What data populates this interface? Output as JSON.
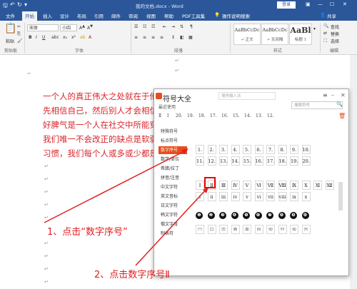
{
  "titlebar": {
    "document_title": "我的文档.docx  -  Word",
    "login": "登录",
    "window_icons": [
      "restore-icon",
      "minimize-icon",
      "maximize-icon",
      "close-icon"
    ]
  },
  "ribbon_tabs": [
    "文件",
    "开始",
    "插入",
    "设计",
    "布局",
    "引用",
    "邮件",
    "审阅",
    "视图",
    "帮助",
    "PDF工具集",
    "操作说明搜索",
    "共享"
  ],
  "ribbon": {
    "clipboard": {
      "label": "剪贴板",
      "paste": "粘贴"
    },
    "font": {
      "label": "字体",
      "font_name": "宋体",
      "font_size": "小四",
      "bold": "B",
      "italic": "I",
      "underline": "U"
    },
    "paragraph": {
      "label": "段落"
    },
    "styles": {
      "label": "样式",
      "items": [
        {
          "preview": "AaBbCcDc",
          "name": "↵ 正文"
        },
        {
          "preview": "AaBbCcDc",
          "name": "↵ 无间隔"
        },
        {
          "preview": "AaBl",
          "name": "标题 1"
        }
      ]
    },
    "editing": {
      "label": "编辑",
      "find": "查找",
      "replace": "替换",
      "select": "选择"
    }
  },
  "document": {
    "lines": [
      "一个人的真正伟大之处就在于他能",
      "先相信自己，然后别人才会相信你",
      "好脾气是一个人在社交中所能穿着",
      "我们唯一不会改正的缺点是软弱。",
      "习惯，我们每个人或多或少都是它"
    ]
  },
  "dialog": {
    "title": "符号大全",
    "input_placeholder": "搜狗输入法",
    "search_placeholder": "搜索符号",
    "recent_label": "最近使用",
    "recent_items": [
      "Ⅱ",
      "Ⅰ",
      "20.",
      "19.",
      "18.",
      "17.",
      "16.",
      "15.",
      "14.",
      "13.",
      "12."
    ],
    "categories": [
      "特殊符号",
      "标点符号",
      "数字序号",
      "数学/单位",
      "希腊/拉丁",
      "拼音/注音",
      "中文字符",
      "英文音标",
      "日文字符",
      "韩文字符",
      "俄文字母",
      "制表符"
    ],
    "selected_category": "数字序号",
    "grid_rows": [
      [
        "1.",
        "2.",
        "3.",
        "4.",
        "5.",
        "6.",
        "7.",
        "8.",
        "9.",
        "10."
      ],
      [
        "11.",
        "12.",
        "13.",
        "14.",
        "15.",
        "16.",
        "17.",
        "18.",
        "19.",
        "20."
      ],
      [
        "Ⅰ",
        "Ⅱ",
        "Ⅲ",
        "Ⅳ",
        "Ⅴ",
        "Ⅵ",
        "Ⅶ",
        "Ⅷ",
        "Ⅸ",
        "Ⅹ",
        "Ⅺ",
        "Ⅻ"
      ],
      [
        "ⅰ",
        "ⅱ",
        "ⅲ",
        "ⅳ",
        "ⅴ",
        "ⅵ",
        "ⅶ",
        "ⅷ",
        "ⅸ",
        "ⅹ"
      ],
      [
        "❶",
        "❷",
        "❸",
        "❹",
        "❺",
        "❻",
        "❼",
        "❽",
        "❾",
        "❿"
      ],
      [
        "㈠",
        "㈡",
        "㈢",
        "㈣",
        "㈤",
        "㈥",
        "㈦",
        "㈧",
        "㈨",
        "㈩"
      ]
    ]
  },
  "annotations": {
    "step1": "1、点击“数字序号”",
    "step2": "2、点击数字序号Ⅱ"
  },
  "colors": {
    "accent": "#2b579a",
    "dialog_accent": "#e84d1c",
    "annotation": "#e02020"
  }
}
